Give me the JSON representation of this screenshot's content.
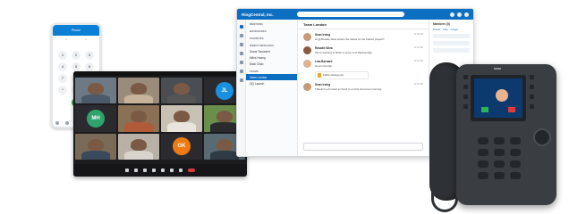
{
  "mobile": {
    "header": "Phone",
    "keys": [
      "1",
      "2",
      "3",
      "4",
      "5",
      "6",
      "7",
      "8",
      "9",
      "*",
      "0",
      "#"
    ],
    "call_color": "#27a844"
  },
  "meeting": {
    "tiles": [
      {
        "kind": "video",
        "bg": "#6d7a86",
        "shirt": "#4a5a6a"
      },
      {
        "kind": "video",
        "bg": "#9a8b7a",
        "shirt": "#c7b39a"
      },
      {
        "kind": "video",
        "bg": "#4a4d52",
        "shirt": "#555"
      },
      {
        "kind": "avatar",
        "initials": "JL",
        "color": "#1a90e0",
        "bg": "#2b2b2f"
      },
      {
        "kind": "avatar",
        "initials": "MH",
        "color": "#2fa36b",
        "bg": "#2b2b2f"
      },
      {
        "kind": "video",
        "bg": "#8a7055",
        "shirt": "#b05a3a"
      },
      {
        "kind": "video",
        "bg": "#c9c2b4",
        "shirt": "#e9e4dc"
      },
      {
        "kind": "video",
        "bg": "#6b8f4a",
        "shirt": "#2b2b2f"
      },
      {
        "kind": "video",
        "bg": "#7a6a58",
        "shirt": "#3a4a5a"
      },
      {
        "kind": "video",
        "bg": "#b8b2a6",
        "shirt": "#d8d4cc"
      },
      {
        "kind": "avatar",
        "initials": "GK",
        "color": "#f07a12",
        "bg": "#2b2b2f"
      },
      {
        "kind": "video",
        "bg": "#5a6a72",
        "shirt": "#2e3a44"
      }
    ]
  },
  "desktop": {
    "title": "RingCentral, Inc.",
    "sections": [
      {
        "label": "MENTIONS"
      },
      {
        "label": "BOOKMARKS"
      },
      {
        "label": "FAVORITES"
      },
      {
        "label": "DIRECT MESSAGES",
        "items": [
          "Diana Toussaint",
          "Miles Huang",
          "Nikki Chan"
        ]
      },
      {
        "label": "TEAMS",
        "items": [
          "Team London",
          "QQ Launch"
        ]
      }
    ],
    "selected_conversation": "Team London",
    "chat_header": "Team London",
    "messages": [
      {
        "name": "Sean Irving",
        "text": "Hi @Rosalie Silva what's the status on the Fallout project?",
        "time": "11:28 AM",
        "face": "#c49a78"
      },
      {
        "name": "Rosalie Silva",
        "text": "We're working to finish it up by next Wednesday.",
        "time": "11:30 AM",
        "face": "#8a5a3e"
      },
      {
        "name": "Lisa Bernard",
        "text": "Here's the file!",
        "time": "11:32 AM",
        "face": "#e0b090",
        "attachment": "Fallout-strategy.pptx"
      },
      {
        "name": "Sean Irving",
        "text": "Thanks! Let's have a check in on this tomorrow morning.",
        "time": "11:35 AM",
        "face": "#c49a78"
      }
    ],
    "right_panel": {
      "title": "Members (5)",
      "tabs": [
        "Pinned",
        "Files",
        "Images"
      ]
    }
  }
}
